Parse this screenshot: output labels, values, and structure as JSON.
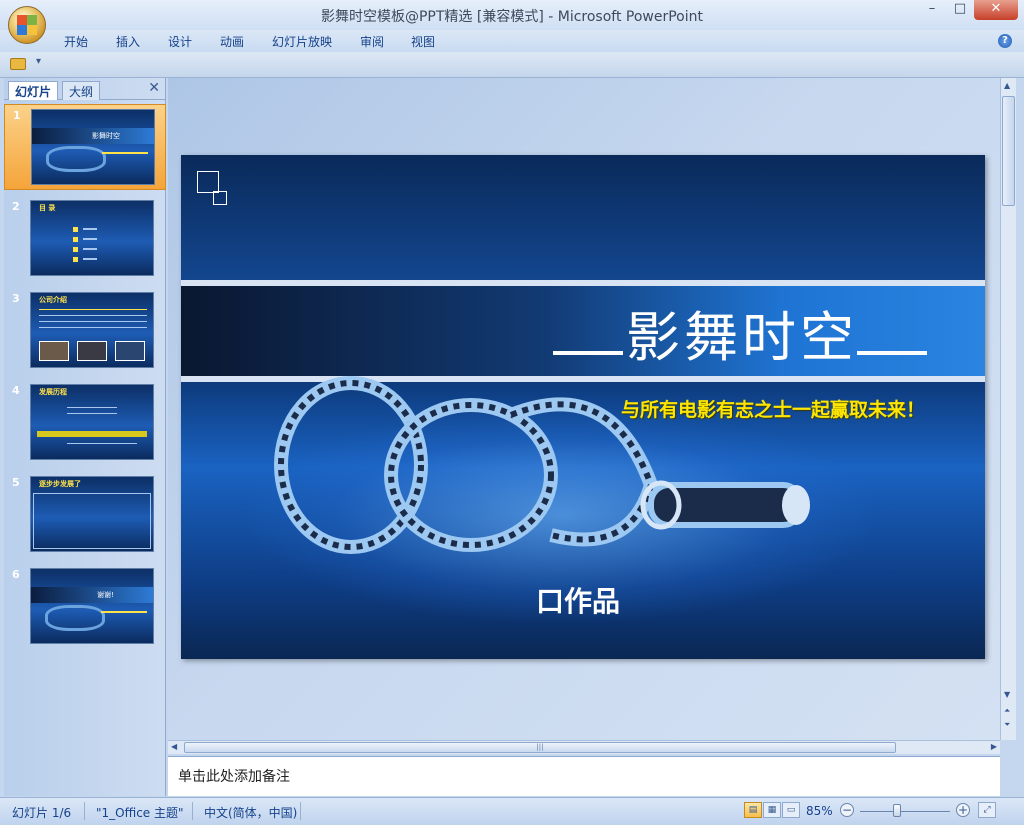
{
  "window": {
    "title": "影舞时空模板@PPT精选 [兼容模式] - Microsoft PowerPoint",
    "minimize": "–",
    "maximize": "□",
    "close": "✕"
  },
  "ribbon": {
    "tabs": [
      "开始",
      "插入",
      "设计",
      "动画",
      "幻灯片放映",
      "审阅",
      "视图"
    ],
    "help": "?"
  },
  "qat": {
    "dropdown": "▾"
  },
  "slides_pane": {
    "tabs": [
      "幻灯片",
      "大纲"
    ],
    "close": "✕",
    "slides": [
      {
        "num": "1",
        "title": "影舞时空"
      },
      {
        "num": "2",
        "title": "目 录"
      },
      {
        "num": "3",
        "title": "公司介绍"
      },
      {
        "num": "4",
        "title": "发展历程"
      },
      {
        "num": "5",
        "title": "逐步步发展了"
      },
      {
        "num": "6",
        "title": "谢谢!"
      }
    ]
  },
  "slide": {
    "title": "影舞时空",
    "subtitle": "与所有电影有志之士一起赢取未来！",
    "author": "口作品"
  },
  "notes": {
    "placeholder": "单击此处添加备注"
  },
  "status": {
    "slide_indicator": "幻灯片 1/6",
    "theme": "\"1_Office 主题\"",
    "language": "中文(简体，中国)",
    "zoom": "85%",
    "zoom_out": "−",
    "zoom_in": "+"
  },
  "colors": {
    "accent_selected": "#f5a43a",
    "slide_bg": "#13468f",
    "subtitle": "#ffe600"
  }
}
